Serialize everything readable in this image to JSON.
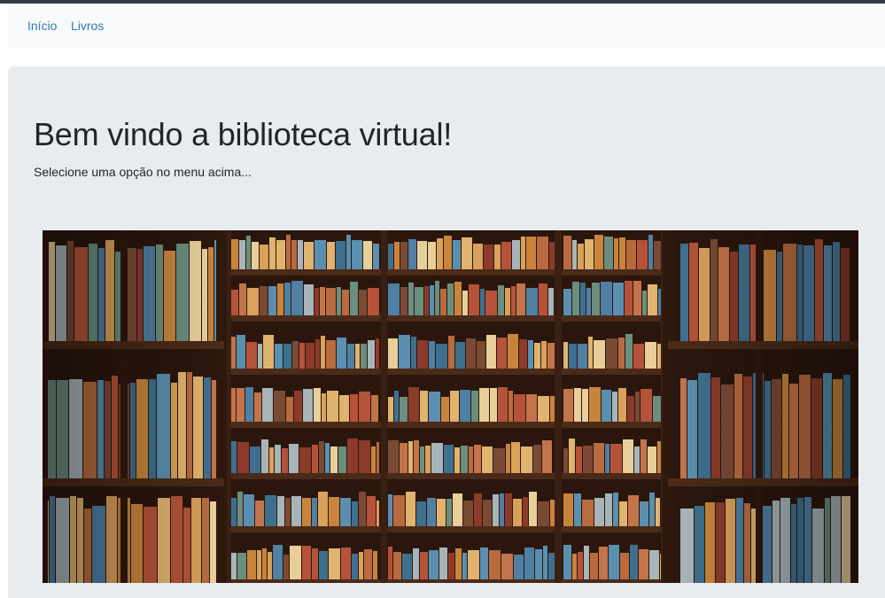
{
  "nav": {
    "items": [
      {
        "label": "Início"
      },
      {
        "label": "Livros"
      }
    ],
    "link_color": "#337ab7"
  },
  "main": {
    "title": "Bem vindo a biblioteca virtual!",
    "subtitle": "Selecione uma opção no menu acima..."
  },
  "image": {
    "subject": "library bookshelves"
  }
}
